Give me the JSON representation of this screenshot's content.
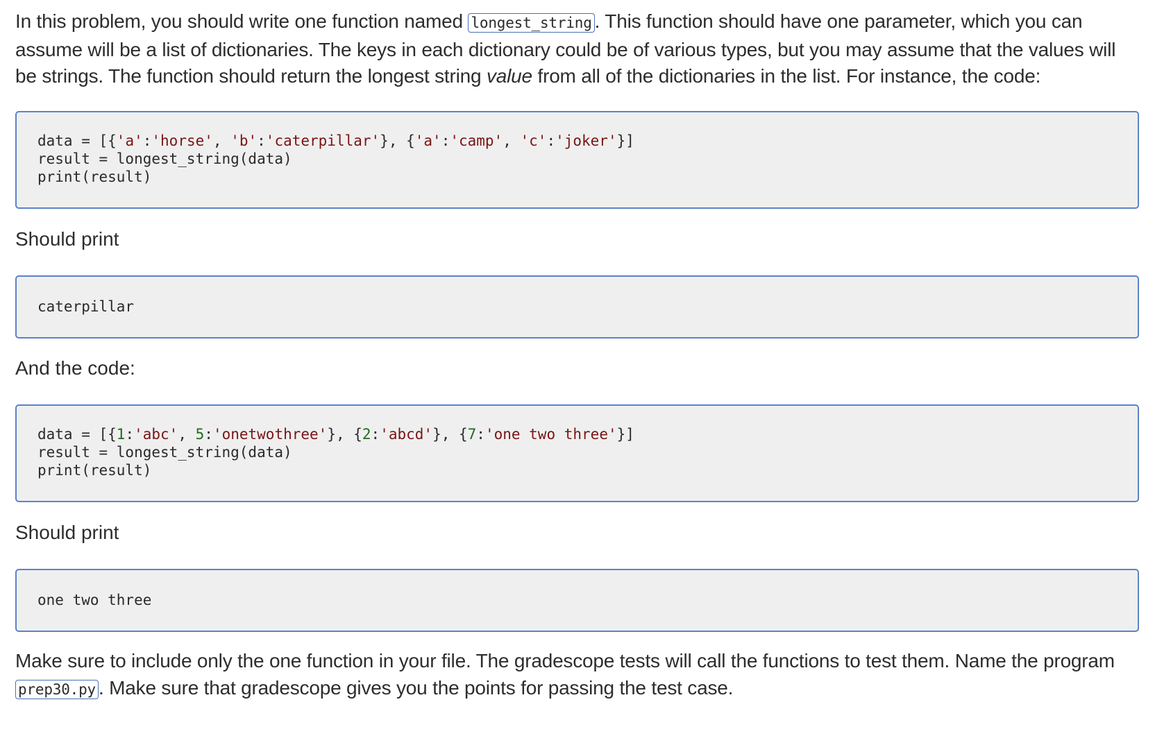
{
  "intro": {
    "part1": "In this problem, you should write one function named ",
    "function_name": "longest_string",
    "part2": ". This function should have one parameter, which you can assume will be a list of dictionaries. The keys in each dictionary could be of various types, but you may assume that the values will be strings. The function should return the longest string ",
    "emphasis": "value",
    "part3": " from all of the dictionaries in the list. For instance, the code:"
  },
  "example1": {
    "line1": {
      "a": "data = [{",
      "s1": "'a'",
      "c1": ":",
      "s2": "'horse'",
      "c2": ", ",
      "s3": "'b'",
      "c3": ":",
      "s4": "'caterpillar'",
      "c4": "}, {",
      "s5": "'a'",
      "c5": ":",
      "s6": "'camp'",
      "c6": ", ",
      "s7": "'c'",
      "c7": ":",
      "s8": "'joker'",
      "c8": "}]"
    },
    "line2": "result = longest_string(data)",
    "line3": "print(result)",
    "should_print_label": "Should print",
    "output": "caterpillar"
  },
  "and_the_code_label": "And the code:",
  "example2": {
    "line1": {
      "a": "data = [{",
      "n1": "1",
      "c1": ":",
      "s1": "'abc'",
      "c2": ", ",
      "n2": "5",
      "c3": ":",
      "s2": "'onetwothree'",
      "c4": "}, {",
      "n3": "2",
      "c5": ":",
      "s3": "'abcd'",
      "c6": "}, {",
      "n4": "7",
      "c7": ":",
      "s4": "'one two three'",
      "c8": "}]"
    },
    "line2": "result = longest_string(data)",
    "line3": "print(result)",
    "should_print_label": "Should print",
    "output": "one two three"
  },
  "closing": {
    "part1": "Make sure to include only the one function in your file. The gradescope tests will call the functions to test them. Name the program ",
    "filename": "prep30.py",
    "part2": ". Make sure that gradescope gives you the points for passing the test case."
  },
  "colors": {
    "code_border": "#5b83c9",
    "code_background": "#efefef",
    "string_literal": "#7a1414",
    "number_literal": "#1d6b1d"
  }
}
